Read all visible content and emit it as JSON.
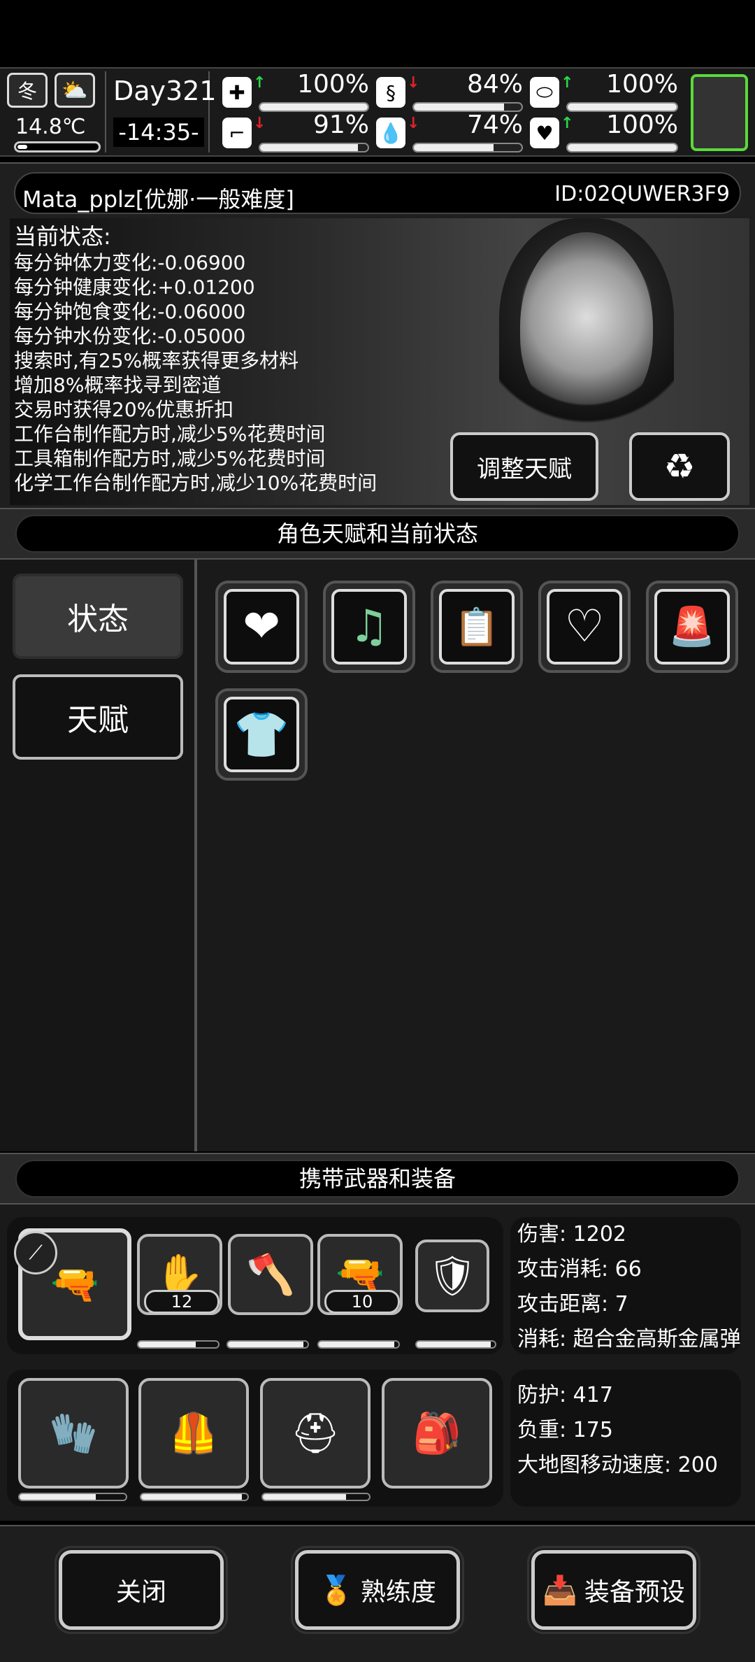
{
  "status": {
    "season": "冬",
    "temperature": "14.8℃",
    "day": "Day321",
    "time": "-14:35-",
    "stats": [
      {
        "name": "medkit",
        "value": "100%",
        "trend": "up",
        "fill": 1.0
      },
      {
        "name": "stomach",
        "value": "84%",
        "trend": "down",
        "fill": 0.84
      },
      {
        "name": "pill",
        "value": "100%",
        "trend": "up",
        "fill": 1.0
      },
      {
        "name": "stamina",
        "value": "91%",
        "trend": "down",
        "fill": 0.91
      },
      {
        "name": "water",
        "value": "74%",
        "trend": "down",
        "fill": 0.74
      },
      {
        "name": "mood",
        "value": "100%",
        "trend": "up",
        "fill": 1.0
      }
    ],
    "colors": {
      "up": "#29d94a",
      "down": "#e0222a",
      "highlight": "#5bd93b"
    }
  },
  "profile": {
    "name": "Mata_pplz[优娜·一般难度]",
    "id": "ID:02QUWER3F9",
    "heading": "当前状态:",
    "lines": [
      "每分钟体力变化:-0.06900",
      "每分钟健康变化:+0.01200",
      "每分钟饱食变化:-0.06000",
      "每分钟水份变化:-0.05000",
      "搜索时,有25%概率获得更多材料",
      "增加8%概率找寻到密道",
      "交易时获得20%优惠折扣",
      "工作台制作配方时,减少5%花费时间",
      "工具箱制作配方时,减少5%花费时间",
      "化学工作台制作配方时,减少10%花费时间"
    ],
    "adjust_talent": "调整天赋"
  },
  "talents": {
    "section_title": "角色天赋和当前状态",
    "tabs": [
      "状态",
      "天赋"
    ],
    "icons": [
      "heart-icon",
      "music-heart-icon",
      "medicine-icon",
      "stomach-icon",
      "alarm-icon",
      "shirt-icon"
    ]
  },
  "equipment": {
    "section_title": "携带武器和装备",
    "weapon_counts": [
      "12",
      "10"
    ],
    "weapon_durability": [
      0.72,
      0.95,
      0.95,
      0.95
    ],
    "armor_durability": [
      0.72,
      0.95,
      0.78
    ],
    "weapon_info": [
      {
        "label": "伤害:",
        "value": "1202"
      },
      {
        "label": "攻击消耗:",
        "value": "66"
      },
      {
        "label": "攻击距离:",
        "value": "7"
      },
      {
        "label": "消耗:",
        "value": "超合金高斯金属弹"
      }
    ],
    "armor_info": [
      {
        "label": "防护:",
        "value": "417"
      },
      {
        "label": "负重:",
        "value": "175"
      },
      {
        "label": "大地图移动速度:",
        "value": "200"
      }
    ]
  },
  "bottom": {
    "close": "关闭",
    "proficiency": "熟练度",
    "preset": "装备预设"
  }
}
